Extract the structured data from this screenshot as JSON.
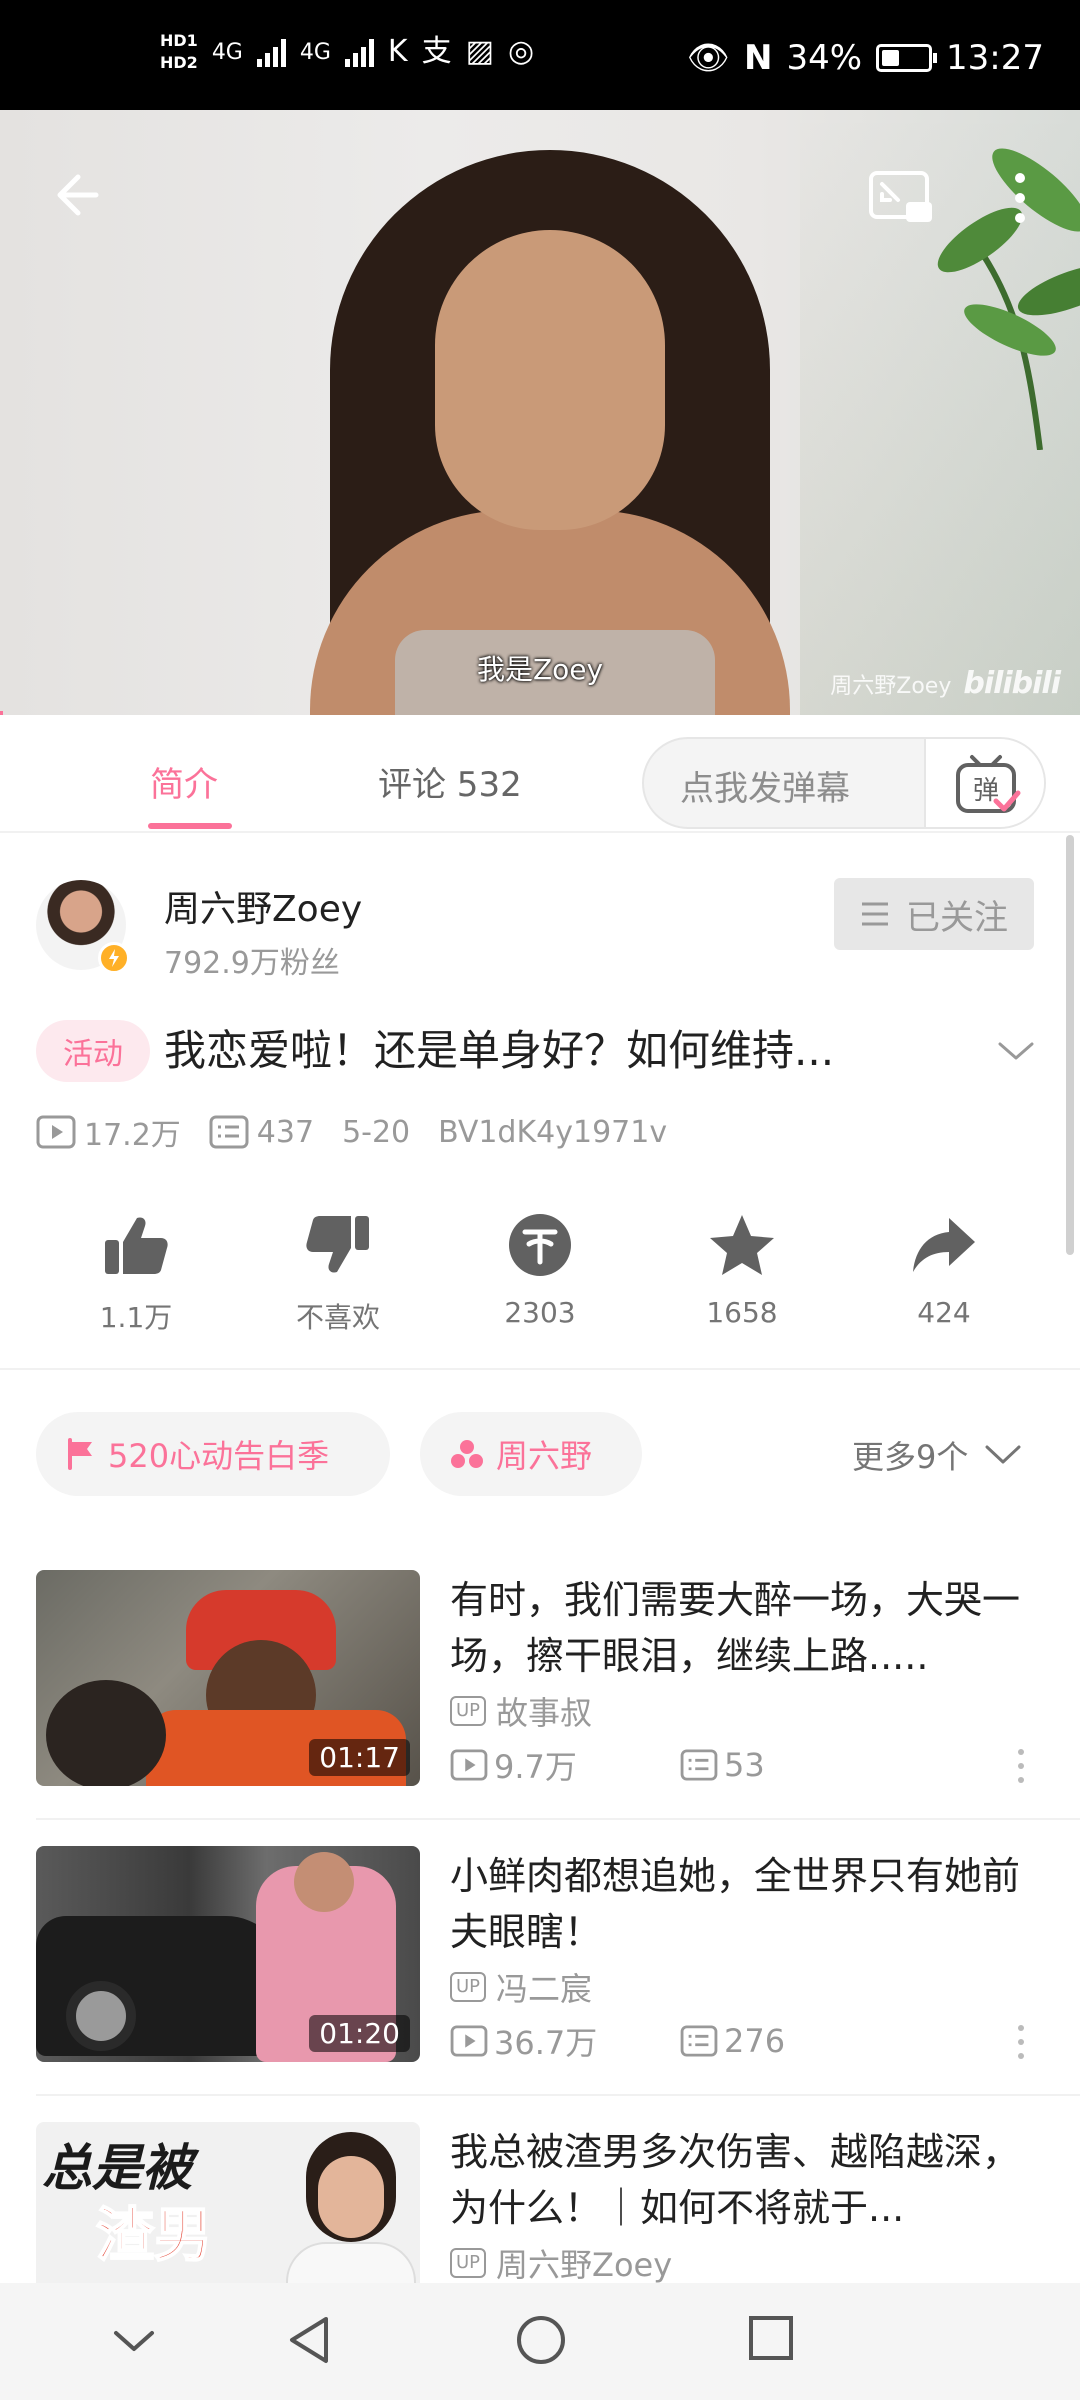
{
  "status_bar": {
    "hd1": "HD1",
    "hd2": "HD2",
    "net1": "4G",
    "net2": "4G",
    "battery_percent": "34%",
    "battery_level": 0.34,
    "time": "13:27"
  },
  "player": {
    "subtitle": "我是Zoey",
    "watermark_name": "周六野Zoey",
    "watermark_brand": "bilibili",
    "progress": 0.003
  },
  "tabs": {
    "intro": "简介",
    "comments": "评论 532",
    "danmaku_placeholder": "点我发弹幕"
  },
  "uploader": {
    "name": "周六野Zoey",
    "fans": "792.9万粉丝",
    "follow_label": "已关注"
  },
  "video": {
    "tag": "活动",
    "title": "我恋爱啦！还是单身好？如何维持...",
    "plays": "17.2万",
    "danmaku_count": "437",
    "date": "5-20",
    "bvid": "BV1dK4y1971v"
  },
  "actions": {
    "like": "1.1万",
    "dislike": "不喜欢",
    "coin": "2303",
    "favorite": "1658",
    "share": "424"
  },
  "topics": {
    "chip1": "520心动告白季",
    "chip2": "周六野",
    "more": "更多9个"
  },
  "related": [
    {
      "title": "有时，我们需要大醉一场，大哭一场，擦干眼泪，继续上路.....",
      "up": "故事叔",
      "plays": "9.7万",
      "danmaku": "53",
      "duration": "01:17"
    },
    {
      "title": "小鲜肉都想追她，全世界只有她前夫眼瞎！",
      "up": "冯二宸",
      "plays": "36.7万",
      "danmaku": "276",
      "duration": "01:20"
    },
    {
      "title": "我总被渣男多次伤害、越陷越深，为什么！｜如何不将就于...",
      "up": "周六野Zoey",
      "plays": "",
      "danmaku": "",
      "duration": ""
    }
  ],
  "thumb3_text": {
    "line1": "总是被",
    "line2": "渣男"
  },
  "up_badge": "UP",
  "colors": {
    "accent": "#fb7299",
    "text": "#212121",
    "muted": "#999999"
  }
}
